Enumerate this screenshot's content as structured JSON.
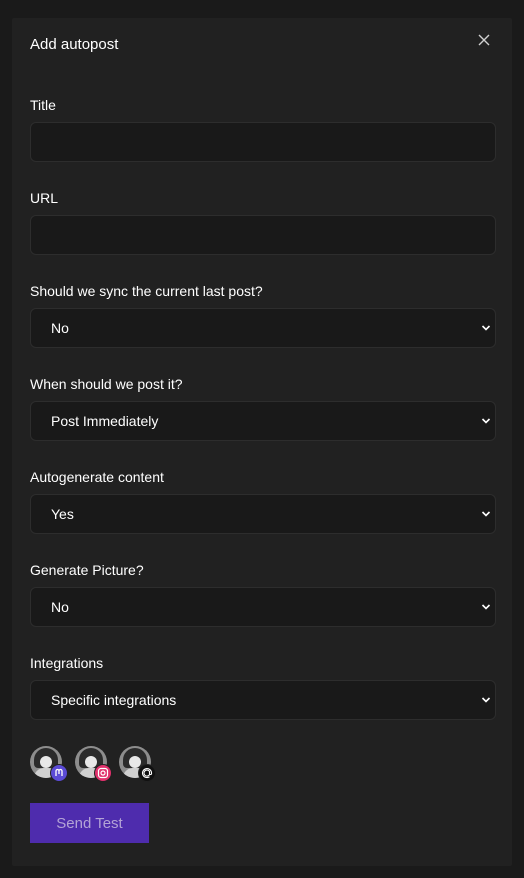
{
  "modal": {
    "title": "Add autopost"
  },
  "fields": {
    "title": {
      "label": "Title",
      "value": ""
    },
    "url": {
      "label": "URL",
      "value": ""
    },
    "sync": {
      "label": "Should we sync the current last post?",
      "value": "No"
    },
    "when": {
      "label": "When should we post it?",
      "value": "Post Immediately"
    },
    "autogenerate": {
      "label": "Autogenerate content",
      "value": "Yes"
    },
    "picture": {
      "label": "Generate Picture?",
      "value": "No"
    },
    "integrations": {
      "label": "Integrations",
      "value": "Specific integrations"
    }
  },
  "integration_avatars": [
    {
      "platform": "mastodon",
      "badge_icon": "mastodon-icon",
      "badge_color": "#5b4bd6"
    },
    {
      "platform": "instagram",
      "badge_icon": "instagram-icon",
      "badge_color": "#e1306c"
    },
    {
      "platform": "threads",
      "badge_icon": "threads-icon",
      "badge_color": "#111111"
    }
  ],
  "actions": {
    "send_test": "Send Test"
  },
  "colors": {
    "accent": "#4e2cad",
    "panel": "#212121",
    "input_bg": "#191919"
  }
}
